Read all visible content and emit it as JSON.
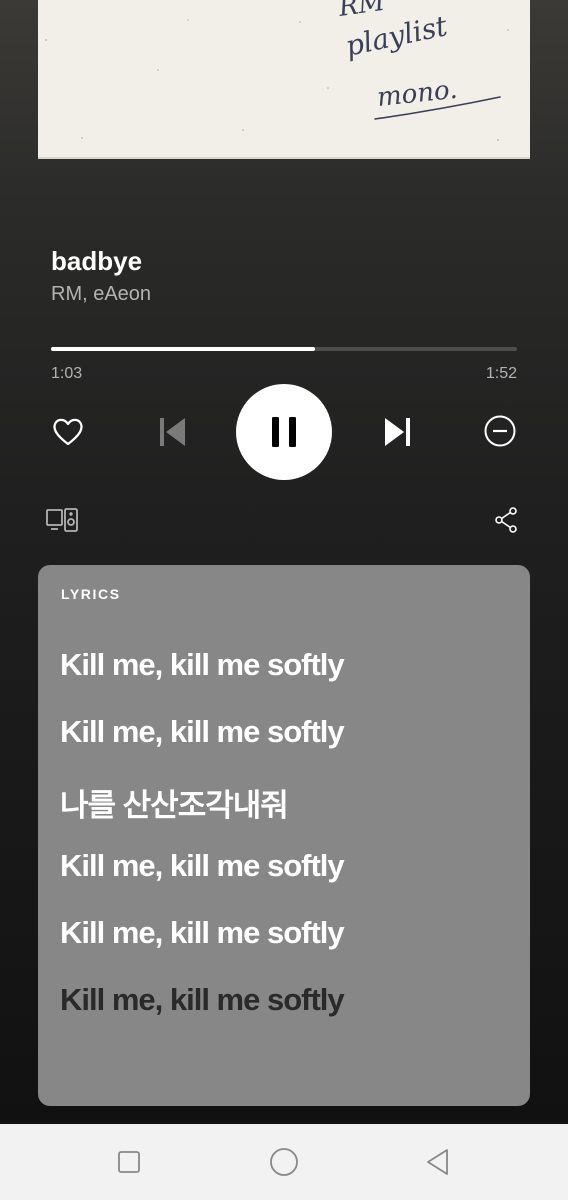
{
  "album": {
    "handwriting_lines": [
      "RM",
      "playlist",
      "mono."
    ]
  },
  "track": {
    "title": "badbye",
    "artist": "RM, eAeon"
  },
  "playback": {
    "elapsed": "1:03",
    "duration": "1:52",
    "progress_fraction": 0.566
  },
  "controls": {
    "icons": [
      "heart-icon",
      "previous-icon",
      "pause-icon",
      "next-icon",
      "block-icon",
      "devices-icon",
      "share-icon"
    ]
  },
  "lyrics": {
    "header": "LYRICS",
    "lines": [
      {
        "text": "Kill me, kill me softly",
        "state": "active"
      },
      {
        "text": "Kill me, kill me softly",
        "state": "active"
      },
      {
        "text": "나를 산산조각내줘",
        "state": "active"
      },
      {
        "text": "Kill me, kill me softly",
        "state": "active"
      },
      {
        "text": "Kill me, kill me softly",
        "state": "active"
      },
      {
        "text": "Kill me, kill me softly",
        "state": "upcoming"
      }
    ]
  },
  "colors": {
    "card": "#878787",
    "accent_text": "#ffffff",
    "muted_text": "#b3b3b3",
    "upcoming_lyric": "#2a2a2a"
  },
  "navbar": {
    "icons": [
      "recent-apps-icon",
      "home-icon",
      "back-icon"
    ]
  }
}
